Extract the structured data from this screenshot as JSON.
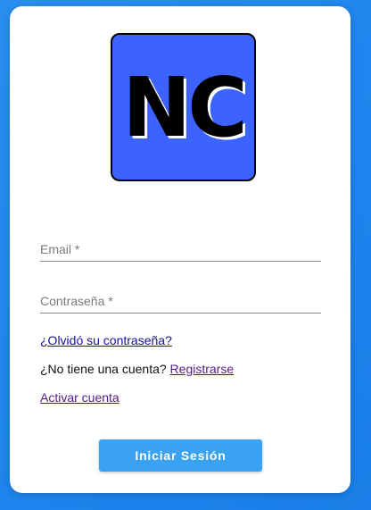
{
  "logo": {
    "text": "NC",
    "bg_color": "#3d63ff"
  },
  "form": {
    "email_placeholder": "Email *",
    "email_value": "",
    "password_placeholder": "Contraseña *",
    "password_value": ""
  },
  "links": {
    "forgot_password": "¿Olvidó su contraseña?",
    "no_account_text": "¿No tiene una cuenta?",
    "register": "Registrarse",
    "activate_account": "Activar cuenta"
  },
  "actions": {
    "login_label": "Iniciar Sesión"
  },
  "colors": {
    "background": "#2b8ef0",
    "button": "#3aa2f3",
    "link_blue": "#1a0dab",
    "link_visited": "#551a8b"
  }
}
